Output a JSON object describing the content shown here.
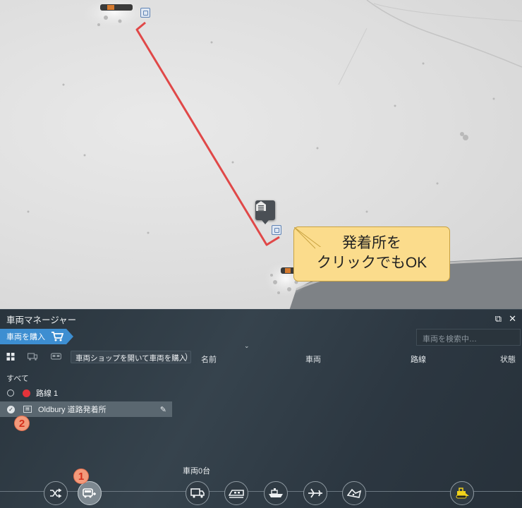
{
  "map": {
    "callout_line1": "発着所を",
    "callout_line2": "クリックでもOK",
    "route_color": "#e04848"
  },
  "panel": {
    "title": "車両マネージャー",
    "popout_icon": "external-link-icon",
    "close_icon": "close-icon",
    "buy_tab_label": "車両を購入",
    "search_placeholder": "車両を検索中…",
    "tooltip": "車両ショップを開いて車両を購入",
    "columns": [
      "名前",
      "車両",
      "路線",
      "状態"
    ],
    "filter_all": "すべて",
    "list": [
      {
        "label": "路線 1",
        "color": "#e5333a",
        "selected": false
      },
      {
        "label": "Oldbury 道路発着所",
        "selected": true
      }
    ],
    "vehicle_count": "車両0台",
    "step_badges": [
      "1",
      "2"
    ]
  },
  "toolbar": {
    "buttons": [
      "shuffle-icon",
      "bus-route-icon",
      "truck-icon",
      "train-icon",
      "ship-icon",
      "plane-icon",
      "map-region-icon",
      "construction-icon"
    ]
  }
}
